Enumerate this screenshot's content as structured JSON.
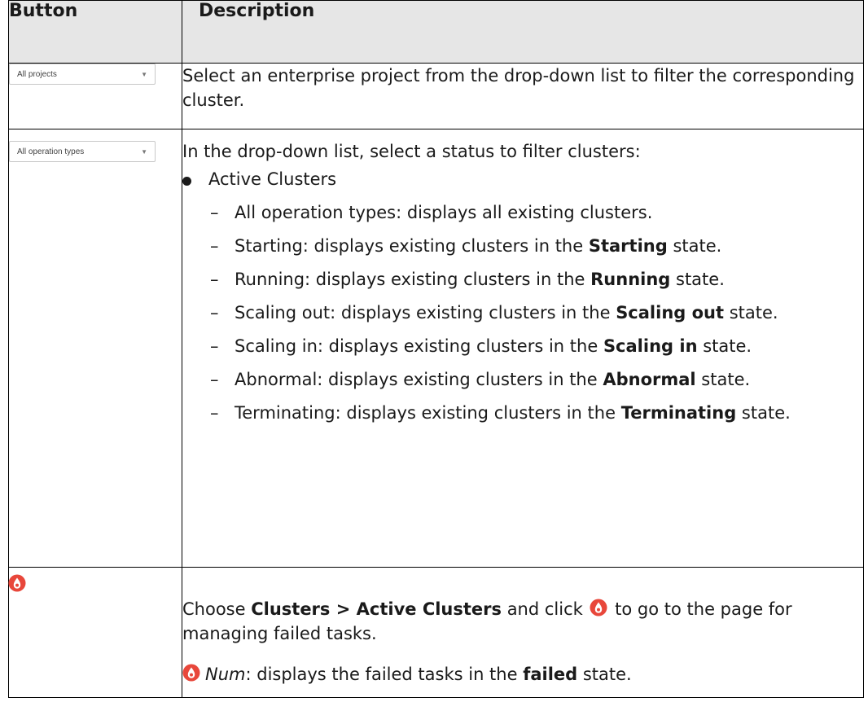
{
  "header": {
    "col_button": "Button",
    "col_description": "Description"
  },
  "rows": [
    {
      "button": {
        "type": "dropdown",
        "value": "All projects",
        "icon": "chevron-down-icon"
      },
      "description": "Select an enterprise project from the drop-down list to filter the corresponding cluster."
    },
    {
      "button": {
        "type": "dropdown",
        "value": "All operation types",
        "icon": "chevron-down-icon"
      },
      "intro": "In the drop-down list, select a status to filter clusters:",
      "group": "Active Clusters",
      "items": [
        {
          "pre": "All operation types: displays all existing clusters.",
          "bold": "",
          "post": ""
        },
        {
          "pre": "Starting: displays existing clusters in the ",
          "bold": "Starting",
          "post": " state."
        },
        {
          "pre": "Running: displays existing clusters in the ",
          "bold": "Running",
          "post": " state."
        },
        {
          "pre": "Scaling out: displays existing clusters in the ",
          "bold": "Scaling out",
          "post": " state."
        },
        {
          "pre": "Scaling in: displays existing clusters in the ",
          "bold": "Scaling in",
          "post": " state."
        },
        {
          "pre": "Abnormal: displays existing clusters in the ",
          "bold": "Abnormal",
          "post": " state."
        },
        {
          "pre": "Terminating: displays existing clusters in the ",
          "bold": "Terminating",
          "post": " state."
        }
      ]
    },
    {
      "button": {
        "type": "icon",
        "icon": "failed-task-icon",
        "color": "#e8473b"
      },
      "line1": {
        "pre": "Choose ",
        "bold": "Clusters > Active Clusters",
        "mid": " and click ",
        "post": " to go to the page for managing failed tasks."
      },
      "line2": {
        "italic": "Num",
        "pre": ": displays the failed tasks in the ",
        "bold": "failed",
        "post": " state."
      }
    }
  ]
}
